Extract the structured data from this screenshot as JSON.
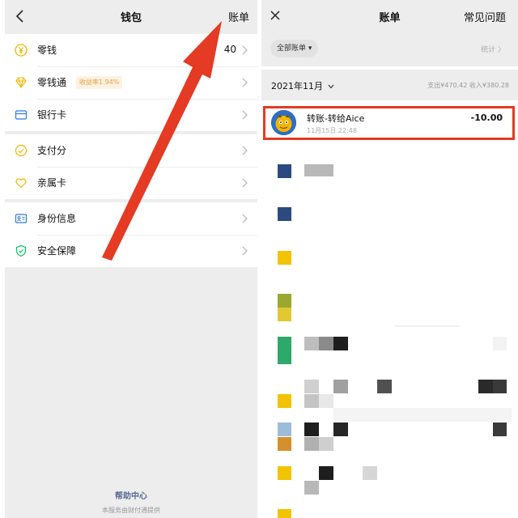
{
  "left_panel": {
    "nav": {
      "title": "钱包",
      "right_link": "账单"
    },
    "group1": [
      {
        "label": "零钱",
        "icon": "yuan-coin-icon",
        "value": "40"
      },
      {
        "label": "零钱通",
        "icon": "diamond-icon",
        "badge": "收益率1.94%"
      },
      {
        "label": "银行卡",
        "icon": "bank-card-icon"
      }
    ],
    "group2": [
      {
        "label": "支付分",
        "icon": "pay-score-icon"
      },
      {
        "label": "亲属卡",
        "icon": "family-card-icon"
      }
    ],
    "group3": [
      {
        "label": "身份信息",
        "icon": "id-card-icon"
      },
      {
        "label": "安全保障",
        "icon": "shield-icon"
      }
    ],
    "footer": {
      "help": "帮助中心",
      "provider": "本服务由财付通提供"
    }
  },
  "right_panel": {
    "nav": {
      "title": "账单",
      "right_link": "常见问题"
    },
    "filter": {
      "label": "全部账单 ▾",
      "stats": "统计 〉"
    },
    "month": {
      "label": "2021年11月",
      "summary": "支出¥470.42  收入¥380.28"
    },
    "highlighted_bill": {
      "name": "转账-转给Aice",
      "time": "11月15日 22:48",
      "amount": "-10.00"
    }
  },
  "colors": {
    "highlight": "#e53a23",
    "icon_green": "#07c160",
    "icon_yellow": "#f2b600",
    "link_blue": "#576b95"
  }
}
